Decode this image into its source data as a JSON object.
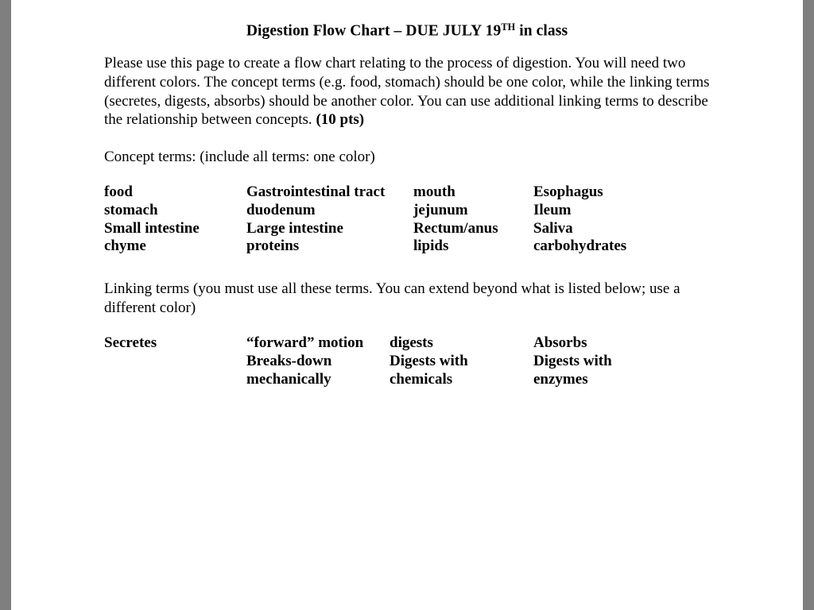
{
  "page": {
    "background_color": "#7f7f7f",
    "sheet_color": "#ffffff",
    "text_color": "#000000"
  },
  "title": {
    "before_sup": "Digestion Flow Chart – DUE JULY 19",
    "sup": "TH",
    "after_sup": " in class"
  },
  "intro": {
    "text": "Please use this page to create a flow chart relating to the process of digestion. You will need two different colors. The concept terms (e.g. food, stomach) should be one color, while the linking terms (secretes, digests, absorbs) should be another color. You can use additional linking terms to describe the relationship between concepts. ",
    "points": "(10 pts)"
  },
  "concept_heading": "Concept terms: (include all terms: one color)",
  "concept_terms": {
    "rows": [
      [
        "food",
        "Gastrointestinal tract",
        "mouth",
        "Esophagus"
      ],
      [
        "stomach",
        "duodenum",
        "jejunum",
        "Ileum"
      ],
      [
        "Small intestine",
        "Large intestine",
        "Rectum/anus",
        "Saliva"
      ],
      [
        "chyme",
        "proteins",
        "lipids",
        "carbohydrates"
      ]
    ]
  },
  "linking_heading": "Linking terms (you must use all these terms. You can extend beyond what is listed below; use a different color)",
  "linking_terms": {
    "rows": [
      [
        "Secretes",
        "“forward” motion",
        "digests",
        "Absorbs"
      ],
      [
        "",
        "Breaks-down",
        "Digests with",
        "Digests with"
      ],
      [
        "",
        "mechanically",
        "chemicals",
        "enzymes"
      ]
    ]
  }
}
